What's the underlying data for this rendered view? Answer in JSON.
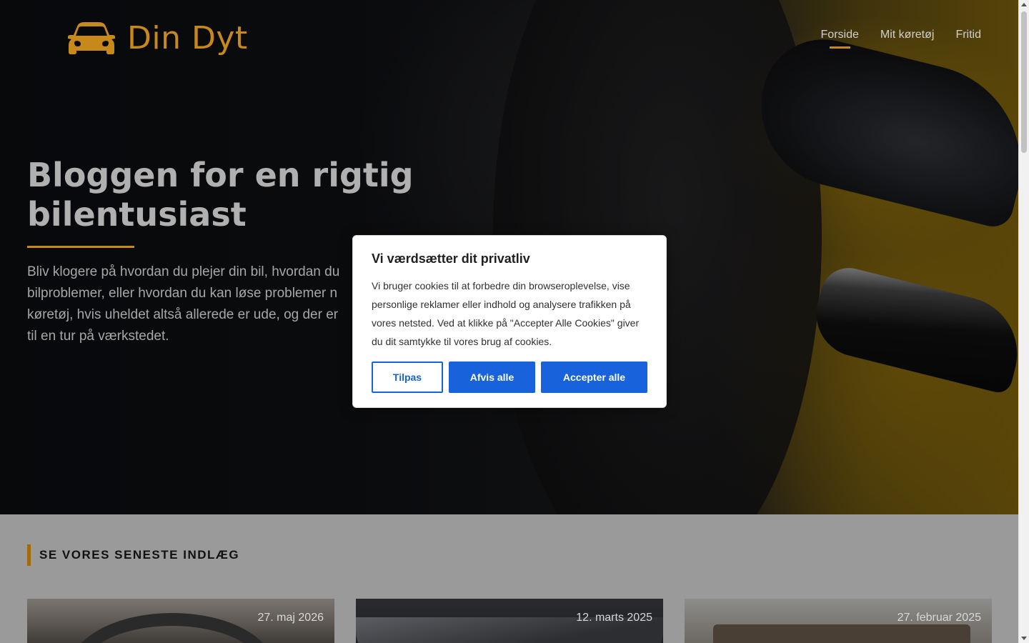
{
  "brand": {
    "name": "Din Dyt",
    "accent_color": "#c7891a",
    "logo_icon": "car-icon"
  },
  "nav": {
    "items": [
      {
        "label": "Forside",
        "active": true
      },
      {
        "label": "Mit køretøj",
        "active": false
      },
      {
        "label": "Fritid",
        "active": false
      }
    ]
  },
  "hero": {
    "title": "Bloggen for en rigtig bilentusiast",
    "text_lines": [
      "Bliv klogere på hvordan du plejer din bil, hvordan du",
      "bilproblemer, eller hvordan du kan løse problemer n",
      "køretøj, hvis uheldet altså allerede er ude, og der er",
      "til en tur på værkstedet."
    ]
  },
  "latest": {
    "title": "SE VORES SENESTE INDLÆG",
    "cards": [
      {
        "date": "27. maj 2026"
      },
      {
        "date": "12. marts 2025"
      },
      {
        "date": "27. februar 2025"
      }
    ]
  },
  "cookie_modal": {
    "title": "Vi værdsætter dit privatliv",
    "body": "Vi bruger cookies til at forbedre din browseroplevelse, vise personlige reklamer eller indhold og analysere trafikken på vores netsted. Ved at klikke på \"Accepter Alle Cookies\" giver du dit samtykke til vores brug af cookies.",
    "customize_label": "Tilpas",
    "reject_label": "Afvis alle",
    "accept_label": "Accepter alle",
    "button_color": "#1863dc"
  }
}
